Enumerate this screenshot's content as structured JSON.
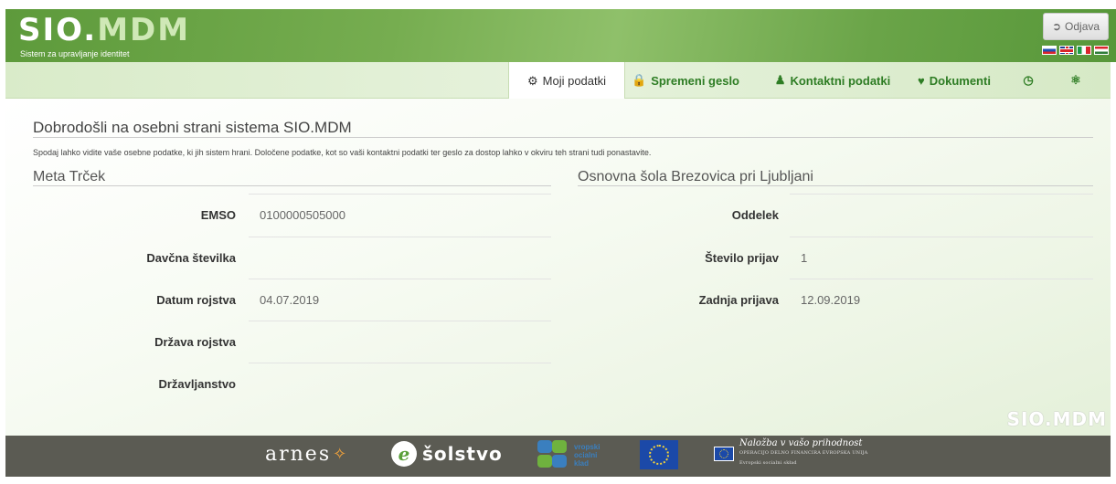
{
  "header": {
    "logo_main": "SIO.",
    "logo_accent": "MDM",
    "subtitle": "Sistem za upravljanje identitet",
    "logout_label": "Odjava",
    "flags": [
      "slovenian-flag",
      "uk-flag",
      "italian-flag",
      "hungarian-flag"
    ]
  },
  "nav": {
    "items": [
      {
        "label": "Moji podatki",
        "icon": "dashboard-icon",
        "active": true
      },
      {
        "label": "Spremeni geslo",
        "icon": "lock-icon"
      },
      {
        "label": "Kontaktni podatki",
        "icon": "user-icon"
      },
      {
        "label": "Dokumenti",
        "icon": "heart-icon"
      },
      {
        "label": "",
        "icon": "clock-icon"
      },
      {
        "label": "",
        "icon": "lifebuoy-icon"
      }
    ]
  },
  "welcome": {
    "title": "Dobrodošli na osebni strani sistema SIO.MDM",
    "text": "Spodaj lahko vidite vaše osebne podatke, ki jih sistem hrani. Določene podatke, kot so vaši kontaktni podatki ter geslo za dostop lahko v okviru teh strani tudi ponastavite."
  },
  "person": {
    "name": "Meta Trček",
    "fields": [
      {
        "label": "EMSO",
        "value": "0100000505000"
      },
      {
        "label": "Davčna številka",
        "value": ""
      },
      {
        "label": "Datum rojstva",
        "value": "04.07.2019"
      },
      {
        "label": "Država rojstva",
        "value": ""
      },
      {
        "label": "Državljanstvo",
        "value": ""
      }
    ]
  },
  "school": {
    "name": "Osnovna šola Brezovica pri Ljubljani",
    "fields": [
      {
        "label": "Oddelek",
        "value": ""
      },
      {
        "label": "Število prijav",
        "value": "1"
      },
      {
        "label": "Zadnja prijava",
        "value": "12.09.2019"
      }
    ]
  },
  "watermark": "SIO.MDM",
  "footer": {
    "arnes": "arnes",
    "solstvo": "šolstvo",
    "esf_lines": [
      "vropski",
      "ocialni",
      "klad"
    ],
    "investment_title": "Naložba v vašo prihodnost",
    "investment_sub": "OPERACIJO DELNO FINANCIRA EVROPSKA UNIJA",
    "investment_sub2": "Evropski socialni skład"
  },
  "colors": {
    "header_green": "#76ad50",
    "nav_text": "#2e7d24",
    "footer": "#5b5b53"
  }
}
